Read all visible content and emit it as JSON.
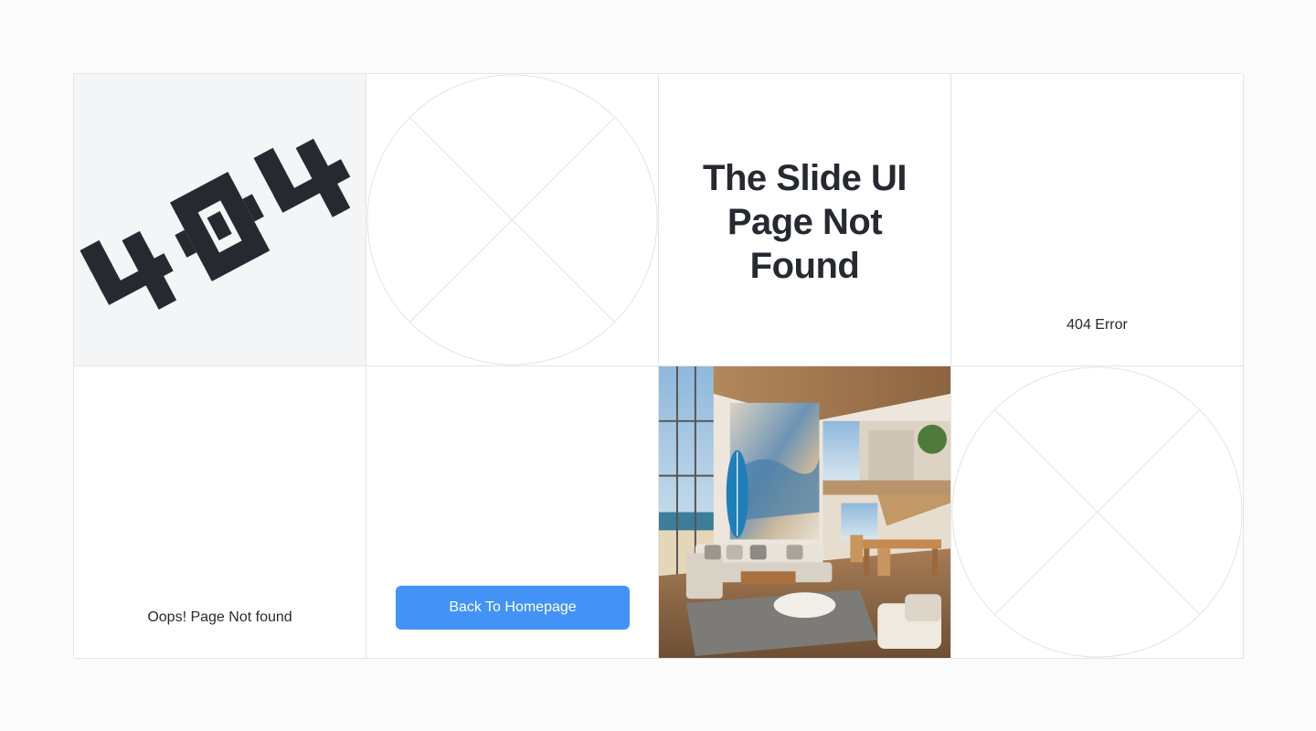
{
  "hero": {
    "logo_text": "404",
    "headline_line1": "The Slide UI",
    "headline_line2": "Page Not",
    "headline_line3": "Found"
  },
  "captions": {
    "error_code": "404 Error",
    "oops": "Oops! Page Not found"
  },
  "actions": {
    "back_home_label": "Back To Homepage"
  },
  "colors": {
    "accent": "#4293f5",
    "text": "#262a30",
    "grid_line": "#e4e4e4"
  },
  "icons": {
    "placeholder": "image-placeholder-icon"
  }
}
